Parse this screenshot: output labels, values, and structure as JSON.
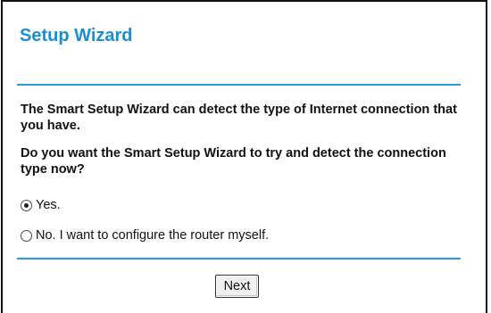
{
  "wizard": {
    "title": "Setup Wizard",
    "description": "The Smart Setup Wizard can detect the type of Internet connection that you have.",
    "question": "Do you want the Smart Setup Wizard to try and detect the connection type now?",
    "options": [
      {
        "label": "Yes.",
        "selected": true
      },
      {
        "label": "No. I want to configure the router myself.",
        "selected": false
      }
    ],
    "next_label": "Next"
  },
  "colors": {
    "title": "#1a8fd0",
    "rule": "#2a9ad8"
  }
}
